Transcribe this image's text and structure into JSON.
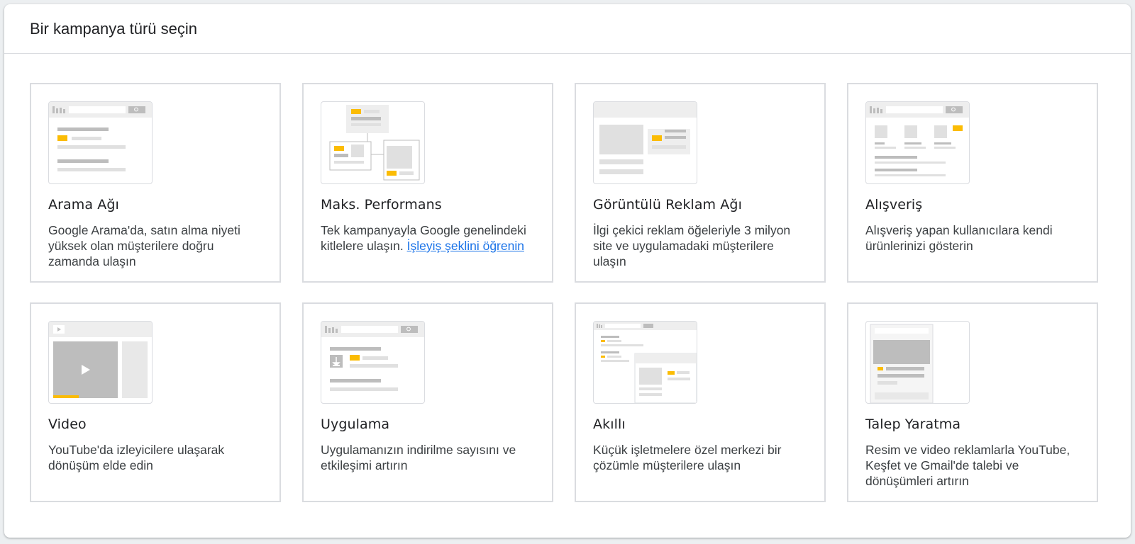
{
  "dialog": {
    "title": "Bir kampanya türü seçin"
  },
  "cards": [
    {
      "title": "Arama Ağı",
      "description": "Google Arama'da, satın alma niyeti yüksek olan müşterilere doğru zamanda ulaşın",
      "icon": "search-campaign-icon"
    },
    {
      "title": "Maks. Performans",
      "description": "Tek kampanyayla Google genelindeki kitlelere ulaşın.",
      "link": "İşleyiş şeklini öğrenin",
      "icon": "performance-max-icon"
    },
    {
      "title": "Görüntülü Reklam Ağı",
      "description": "İlgi çekici reklam öğeleriyle 3 milyon site ve uygulamadaki müşterilere ulaşın",
      "icon": "display-campaign-icon"
    },
    {
      "title": "Alışveriş",
      "description": "Alışveriş yapan kullanıcılara kendi ürünlerinizi gösterin",
      "icon": "shopping-campaign-icon"
    },
    {
      "title": "Video",
      "description": "YouTube'da izleyicilere ulaşarak dönüşüm elde edin",
      "icon": "video-campaign-icon"
    },
    {
      "title": "Uygulama",
      "description": "Uygulamanızın indirilme sayısını ve etkileşimi artırın",
      "icon": "app-campaign-icon"
    },
    {
      "title": "Akıllı",
      "description": "Küçük işletmelere özel merkezi bir çözümle müşterilere ulaşın",
      "icon": "smart-campaign-icon"
    },
    {
      "title": "Talep Yaratma",
      "description": "Resim ve video reklamlarla YouTube, Keşfet ve Gmail'de talebi ve dönüşümleri artırın",
      "icon": "demand-gen-campaign-icon"
    }
  ],
  "colors": {
    "accent_yellow": "#fbbc04",
    "link_blue": "#1a73e8",
    "border_gray": "#dadce0"
  }
}
